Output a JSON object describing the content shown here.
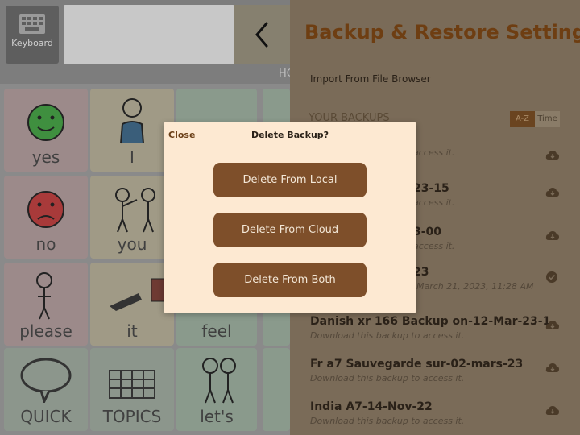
{
  "left_app": {
    "keyboard_label": "Keyboard",
    "home_label": "HO",
    "cells": [
      {
        "label": "yes",
        "color": "#9c8a8a"
      },
      {
        "label": "I",
        "color": "#a09a86"
      },
      {
        "label": "no",
        "color": "#9c8a8a"
      },
      {
        "label": "you",
        "color": "#a09a86"
      },
      {
        "label": "please",
        "color": "#9c8a8a"
      },
      {
        "label": "it",
        "color": "#a09a86"
      },
      {
        "label": "feel",
        "color": "#8a9a8c"
      },
      {
        "label": "QUICK",
        "color": "#8c968c"
      },
      {
        "label": "TOPICS",
        "color": "#8c968c"
      },
      {
        "label": "let's",
        "color": "#8a9a8c"
      }
    ]
  },
  "settings": {
    "title": "Backup & Restore Settings",
    "import_link": "Import From File Browser",
    "backups_label": "YOUR BACKUPS",
    "sort": {
      "az": "A-Z",
      "time": "Time"
    },
    "backups": [
      {
        "name": "",
        "sub": "access it.",
        "icon": "cloud-download-icon"
      },
      {
        "name": "23-15",
        "sub": "access it.",
        "icon": "cloud-download-icon"
      },
      {
        "name": "3-00",
        "sub": "access it.",
        "icon": "cloud-download-icon"
      },
      {
        "name": "23",
        "sub": "March 21, 2023, 11:28 AM",
        "icon": "check-circle-icon"
      },
      {
        "name": "Danish xr 166 Backup on-12-Mar-23-1",
        "sub": "Download this backup to access it.",
        "icon": "cloud-download-icon"
      },
      {
        "name": "Fr a7 Sauvegarde sur-02-mars-23",
        "sub": "Download this backup to access it.",
        "icon": "cloud-download-icon"
      },
      {
        "name": "India A7-14-Nov-22",
        "sub": "Download this backup to access it.",
        "icon": "cloud-download-icon"
      }
    ]
  },
  "dialog": {
    "close": "Close",
    "title": "Delete Backup?",
    "buttons": {
      "local": "Delete From Local",
      "cloud": "Delete From Cloud",
      "both": "Delete From Both"
    }
  }
}
